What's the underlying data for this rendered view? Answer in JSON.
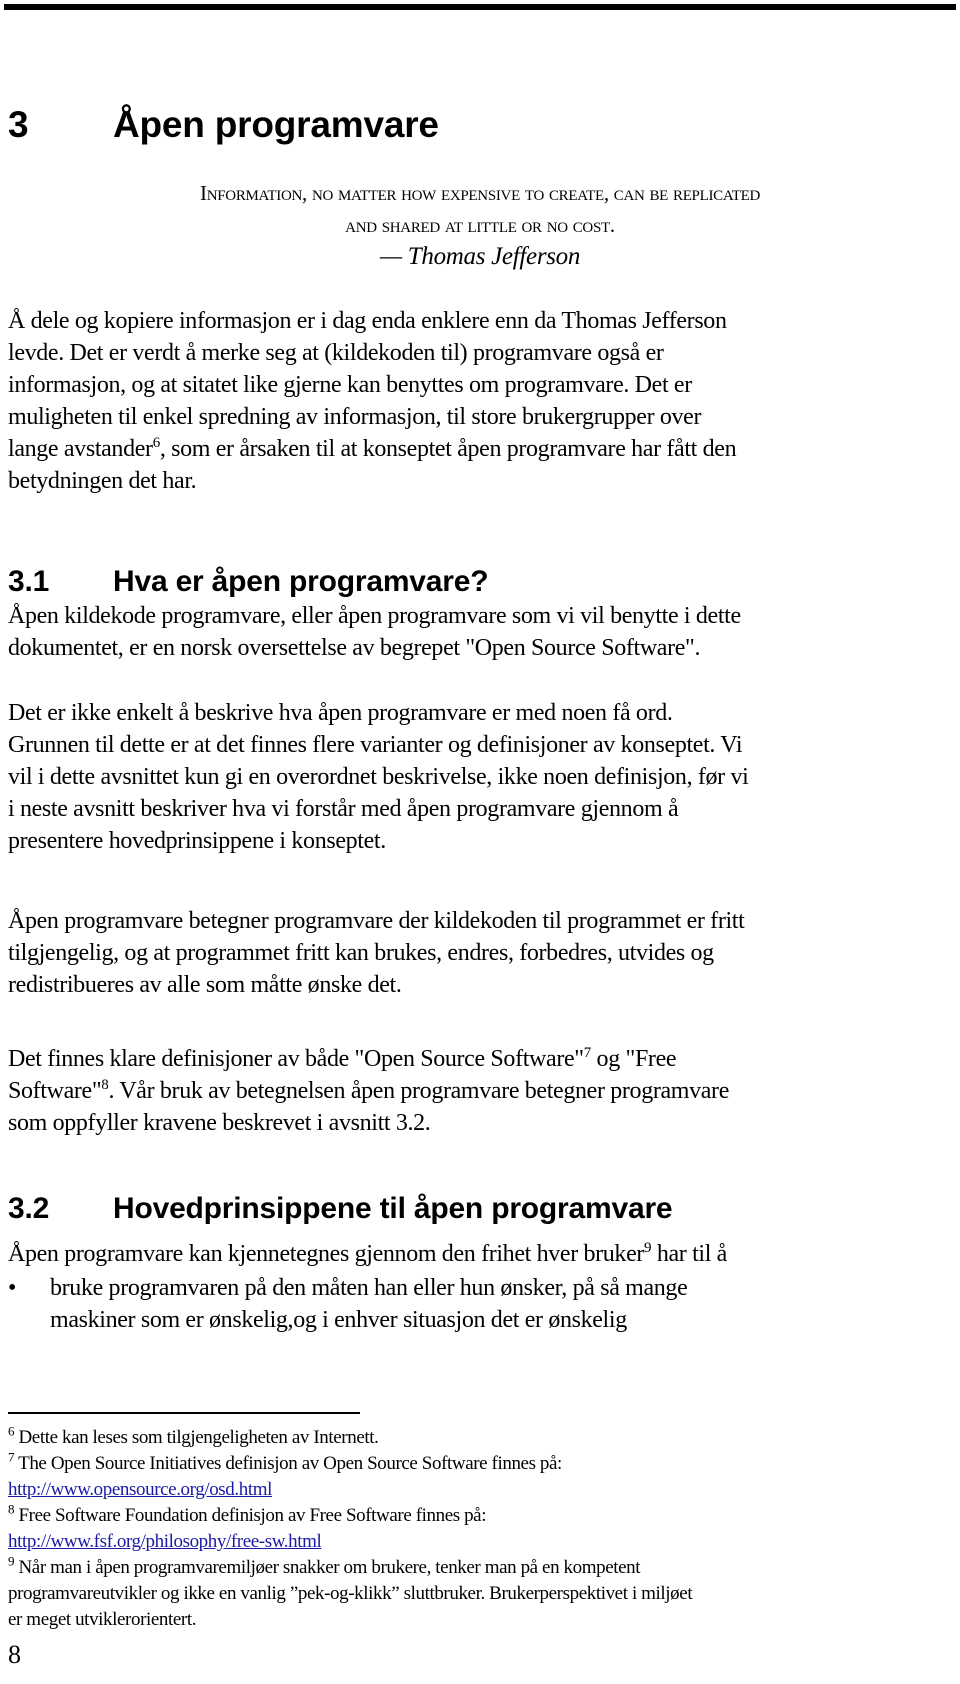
{
  "chapter": {
    "number": "3",
    "title": "Åpen programvare"
  },
  "epigraph": {
    "line1": "Information, no matter how expensive to create, can be  replicated",
    "line2": "and shared at little or no cost.",
    "attribution": "— Thomas Jefferson"
  },
  "intro": {
    "lines": [
      "Å dele og kopiere informasjon er i dag enda enklere enn da Thomas Jefferson",
      "levde. Det er verdt å merke seg at (kildekoden til) programvare også er",
      "informasjon, og at sitatet like gjerne kan benyttes om programvare. Det er",
      "muligheten til enkel spredning av informasjon, til store brukergrupper over"
    ],
    "line5_before": "lange avstander",
    "line5_sup": "6",
    "line5_after": ", som er årsaken til at konseptet åpen programvare har fått den",
    "line6": "betydningen det har."
  },
  "section_3_1": {
    "number": "3.1",
    "title": "Hva er åpen programvare?",
    "para1": [
      "Åpen kildekode programvare, eller åpen programvare som vi vil benytte i dette",
      "dokumentet, er en norsk oversettelse av begrepet \"Open Source Software\"."
    ],
    "para2": [
      "Det er ikke enkelt å beskrive hva åpen programvare er med noen få ord.",
      "Grunnen til dette er at det finnes flere varianter og definisjoner av konseptet. Vi",
      "vil i dette avsnittet kun gi en overordnet beskrivelse, ikke noen definisjon, før vi",
      "i neste avsnitt beskriver hva vi forstår med åpen programvare gjennom å",
      "presentere hovedprinsippene i konseptet."
    ],
    "para3": [
      "Åpen programvare betegner programvare der kildekoden til programmet er fritt",
      "tilgjengelig, og at programmet fritt kan brukes, endres, forbedres, utvides og",
      "redistribueres av alle som måtte ønske det."
    ],
    "para4": {
      "l1_before": "Det finnes klare definisjoner av både \"Open Source Software\"",
      "l1_sup": "7",
      "l1_after": " og \"Free",
      "l2_before": "Software\"",
      "l2_sup": "8",
      "l2_after": ". Vår bruk av betegnelsen åpen programvare betegner programvare",
      "l3": "som oppfyller kravene beskrevet i avsnitt 3.2."
    }
  },
  "section_3_2": {
    "number": "3.2",
    "title": "Hovedprinsippene til åpen programvare",
    "intro_before": "Åpen programvare kan kjennetegnes gjennom den frihet hver bruker",
    "intro_sup": "9",
    "intro_after": " har til å",
    "bullets": [
      {
        "symbol": "•",
        "lines": [
          "bruke programvaren på den måten han eller hun ønsker, på så mange",
          "maskiner som er ønskelig,og i enhver situasjon det er ønskelig"
        ]
      }
    ]
  },
  "footnotes": [
    {
      "num": "6",
      "text": "Dette kan leses som tilgjengeligheten av Internett."
    },
    {
      "num": "7",
      "text": "The Open Source Initiatives definisjon av Open Source Software finnes på:",
      "link": "http://www.opensource.org/osd.html"
    },
    {
      "num": "8",
      "text": "Free Software Foundation definisjon av Free Software finnes på:",
      "link": "http://www.fsf.org/philosophy/free-sw.html"
    },
    {
      "num": "9",
      "lines": [
        "Når man i åpen programvaremiljøer snakker om brukere, tenker man på en kompetent",
        "programvareutvikler og ikke en vanlig ”pek-og-klikk” sluttbruker. Brukerperspektivet i miljøet",
        "er meget utviklerorientert."
      ]
    }
  ],
  "colors": {
    "text": "#000000",
    "link": "#1a1aa6"
  },
  "page_number": "8"
}
